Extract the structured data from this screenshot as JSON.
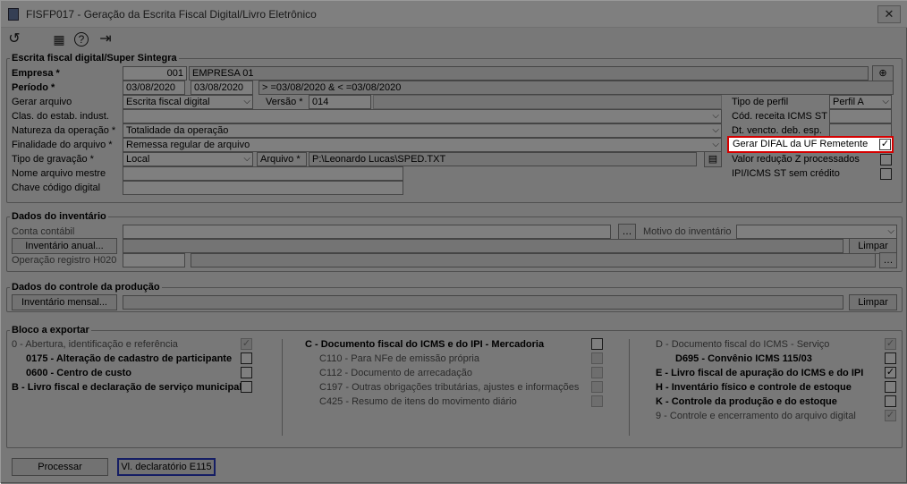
{
  "window": {
    "title": "FISFP017 - Geração da Escrita Fiscal Digital/Livro Eletrônico",
    "close": "✕"
  },
  "toolbar": {
    "refresh": "↺",
    "calendar": "▦",
    "help": "?",
    "exit": "⇥"
  },
  "escrita": {
    "title": "Escrita fiscal digital/Super Sintegra",
    "empresa_label": "Empresa *",
    "empresa_code": "001",
    "empresa_name": "EMPRESA 01",
    "periodo_label": "Período *",
    "periodo_start": "03/08/2020",
    "periodo_end": "03/08/2020",
    "periodo_range": "> =03/08/2020 & < =03/08/2020",
    "gerar_label": "Gerar arquivo",
    "gerar_value": "Escrita fiscal digital",
    "versao_label": "Versão *",
    "versao_value": "014",
    "clas_label": "Clas. do estab. indust.",
    "natureza_label": "Natureza da operação *",
    "natureza_value": "Totalidade da operação",
    "finalidade_label": "Finalidade do arquivo *",
    "finalidade_value": "Remessa regular de arquivo",
    "tipo_grav_label": "Tipo de gravação *",
    "tipo_grav_value": "Local",
    "arquivo_label": "Arquivo *",
    "arquivo_value": "P:\\Leonardo Lucas\\SPED.TXT",
    "nome_label": "Nome arquivo mestre",
    "chave_label": "Chave código digital",
    "tipo_perfil_label": "Tipo de perfil",
    "tipo_perfil_value": "Perfil A",
    "cod_receita_label": "Cód. receita ICMS ST",
    "dt_vencto_label": "Dt. vencto. deb. esp.",
    "difal_label": "Gerar DIFAL da UF Remetente",
    "difal_checked": "✓",
    "reducao_label": "Valor redução Z processados",
    "ipi_label": "IPI/ICMS ST sem crédito"
  },
  "inventario": {
    "title": "Dados do inventário",
    "conta_label": "Conta contábil",
    "motivo_label": "Motivo do inventário",
    "inv_btn": "Inventário anual...",
    "limpar": "Limpar",
    "h020_label": "Operação registro H020"
  },
  "producao": {
    "title": "Dados do controle da produção",
    "inv_btn": "Inventário mensal...",
    "limpar": "Limpar"
  },
  "bloco": {
    "title": "Bloco a exportar",
    "b0": "0 - Abertura, identificação e referência",
    "b0175": "0175 - Alteração de cadastro de participante",
    "b0600": "0600 - Centro de custo",
    "bB": "B - Livro fiscal e declaração de serviço municipal",
    "bC": "C - Documento fiscal do ICMS e do IPI - Mercadoria",
    "c110": "C110 - Para NFe de emissão própria",
    "c112": "C112 - Documento de arrecadação",
    "c197": "C197 - Outras obrigações tributárias, ajustes e informações",
    "c425": "C425 - Resumo de itens do movimento diário",
    "bD": "D - Documento fiscal do ICMS - Serviço",
    "d695": "D695 - Convênio ICMS 115/03",
    "bE": "E - Livro fiscal de apuração do ICMS e do IPI",
    "bH": "H - Inventário físico e controle de estoque",
    "bK": "K - Controle da produção e do estoque",
    "b9": "9 - Controle e encerramento do arquivo digital",
    "check": "✓"
  },
  "footer": {
    "processar": "Processar",
    "vl_decl": "Vl. declaratório E115"
  }
}
